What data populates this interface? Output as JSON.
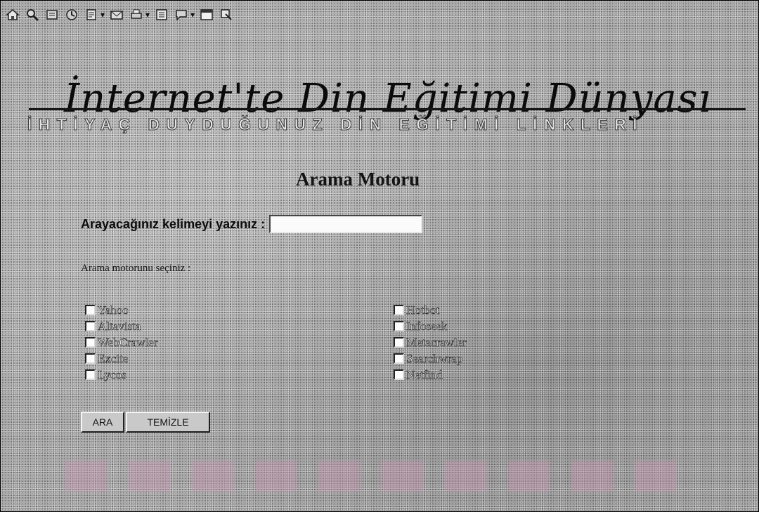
{
  "toolbar": {
    "icons": [
      "home-icon",
      "search-icon",
      "favorites-icon",
      "history-icon",
      "channels-icon",
      "mail-icon",
      "print-icon",
      "edit-icon",
      "discuss-icon",
      "window-icon",
      "translate-icon"
    ]
  },
  "header": {
    "title": "İnternet'te Din Eğitimi Dünyası",
    "subtitle": "İHTİYAÇ DUYDUĞUNUZ DİN EĞİTİMİ LİNKLERİ"
  },
  "search": {
    "heading": "Arama Motoru",
    "label": "Arayacağınız kelimeyi yazınız :",
    "value": "",
    "choose_label": "Arama motorunu seçiniz :"
  },
  "engines": {
    "left": [
      "Yahoo",
      "Altavista",
      "WebCrawler",
      "Excite",
      "Lycos"
    ],
    "right": [
      "Hotbot",
      "Infoseek",
      "Metacrawler",
      "Searchwrap",
      "Netfind"
    ]
  },
  "buttons": {
    "search_label": "ARA",
    "clear_label": "TEMİZLE"
  },
  "colors": {
    "background": "#9d9d9d",
    "text": "#111111"
  }
}
